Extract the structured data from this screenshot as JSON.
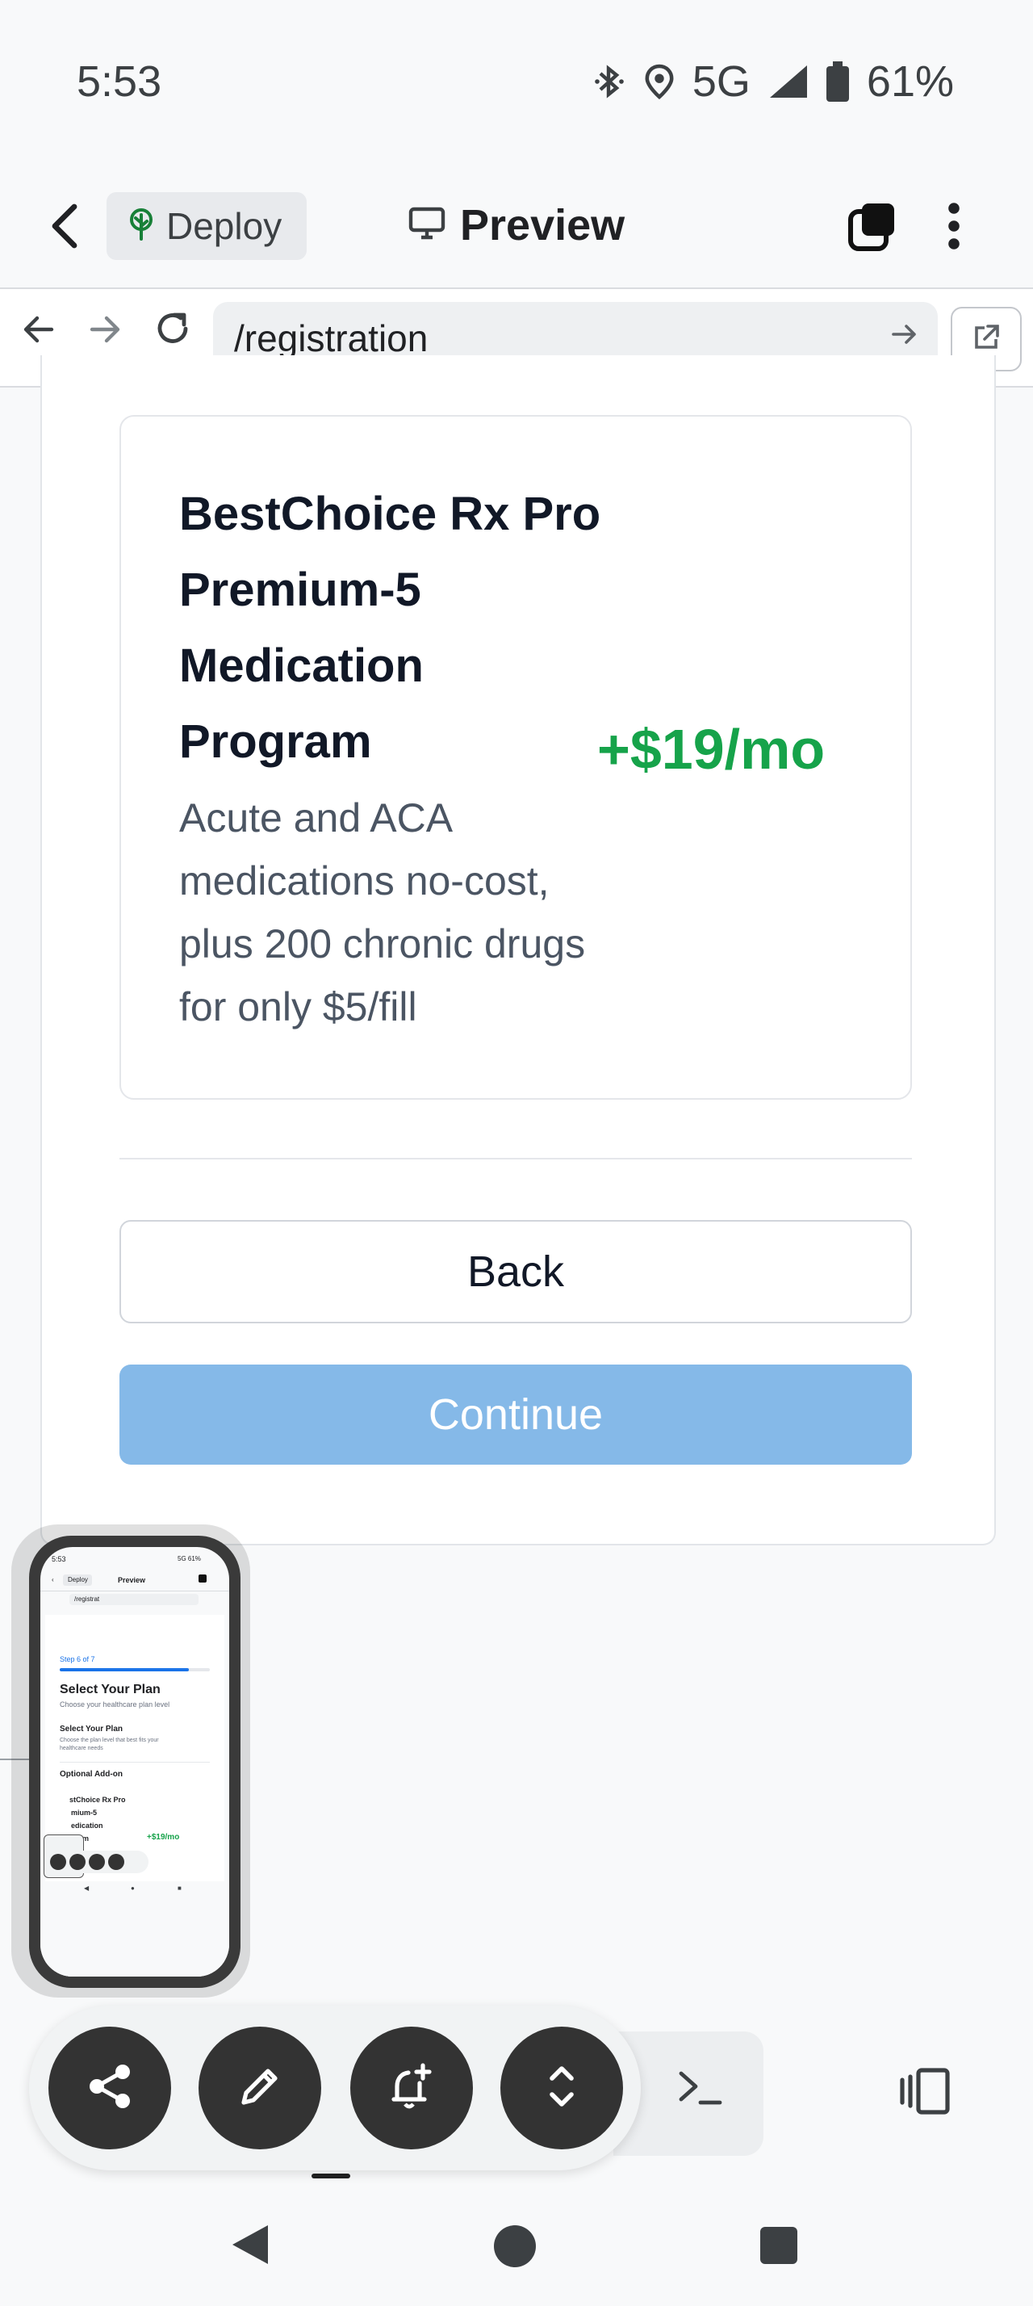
{
  "status_bar": {
    "time": "5:53",
    "network": "5G",
    "battery": "61%",
    "icons": [
      "bluetooth-icon",
      "location-icon",
      "signal-icon",
      "battery-icon"
    ]
  },
  "app_bar": {
    "deploy_label": "Deploy",
    "preview_label": "Preview"
  },
  "address_bar": {
    "url": "/registration"
  },
  "plan": {
    "name": "BestChoice Rx Pro Premium-5 Medication Program",
    "description": "Acute and ACA medications no-cost, plus 200 chronic drugs for only $5/fill",
    "price": "+$19/mo"
  },
  "actions": {
    "back_label": "Back",
    "continue_label": "Continue"
  },
  "mini_preview": {
    "time": "5:53",
    "status": "5G 61%",
    "deploy": "Deploy",
    "preview": "Preview",
    "url": "/registrat",
    "step": "Step 6 of 7",
    "title": "Select Your Plan",
    "subtitle": "Choose your healthcare plan level",
    "section_title": "Select Your Plan",
    "section_desc_1": "Choose the plan level that best fits your",
    "section_desc_2": "healthcare needs",
    "addon": "Optional Add-on",
    "plan_1": "stChoice Rx Pro",
    "plan_2": "mium-5",
    "plan_3": "edication",
    "plan_4": "gram",
    "price": "+$19/mo"
  },
  "colors": {
    "accent_green": "#16a34a",
    "continue_disabled": "#85b9e8",
    "deploy_icon": "#188038"
  }
}
